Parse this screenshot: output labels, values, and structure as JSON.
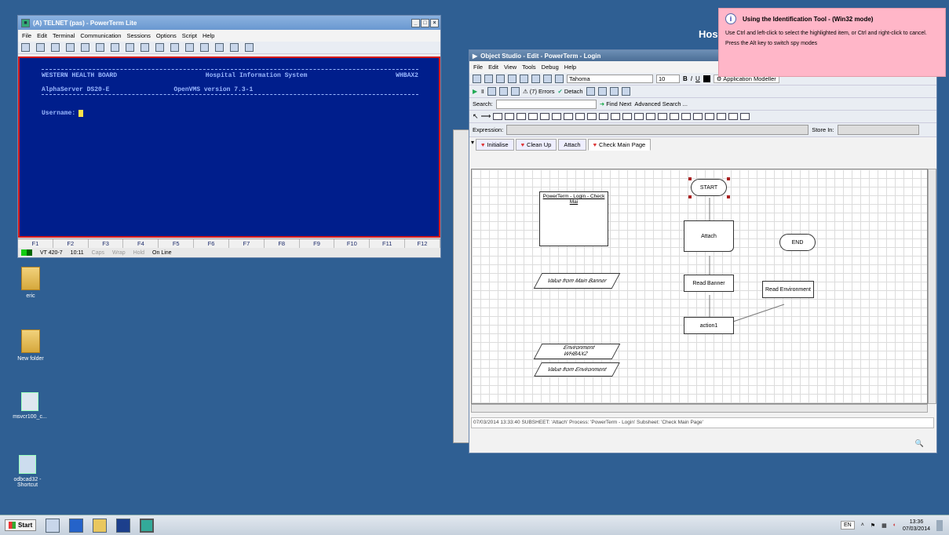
{
  "powerterm": {
    "title": "(A) TELNET (pas) - PowerTerm Lite",
    "menu": [
      "File",
      "Edit",
      "Terminal",
      "Communication",
      "Sessions",
      "Options",
      "Script",
      "Help"
    ],
    "screen": {
      "line1_left": "WESTERN HEALTH BOARD",
      "line1_mid": "Hospital Information System",
      "line1_right": "WHBAX2",
      "line2_left": "AlphaServer DS20-E",
      "line2_mid": "OpenVMS version 7.3-1",
      "username_label": "Username:"
    },
    "fkeys": [
      "F1",
      "F2",
      "F3",
      "F4",
      "F5",
      "F6",
      "F7",
      "F8",
      "F9",
      "F10",
      "F11",
      "F12"
    ],
    "status": [
      "VT 420-7",
      "10:11",
      "Caps",
      "Wrap",
      "Hold",
      "On Line"
    ]
  },
  "desktop_icons": [
    "eric",
    "New folder",
    "msvcr100_c...",
    "odbcad32 - Shortcut"
  ],
  "ide": {
    "title": "Object Studio  - Edit - PowerTerm - Login",
    "menu": [
      "File",
      "Edit",
      "View",
      "Tools",
      "Debug",
      "Help"
    ],
    "font_name": "Tahoma",
    "font_size": "10",
    "app_modeller": "Application Modeller",
    "errors": "(7) Errors",
    "detach": "Detach",
    "search_label": "Search:",
    "find_next": "Find Next",
    "advanced_search": "Advanced Search ...",
    "expression_label": "Expression:",
    "store_in_label": "Store In:",
    "tabs": [
      "Initialise",
      "Clean Up",
      "Attach",
      "Check Main Page"
    ],
    "diagram": {
      "start": "START",
      "end": "END",
      "note": "PowerTerm - Login - Check Mai",
      "attach": "Attach",
      "read_banner": "Read Banner",
      "read_env": "Read Environment",
      "action1": "action1",
      "value_main_banner": "Value from Main Banner",
      "env_line1": "Environment",
      "env_line2": "WHBAX2",
      "value_env": "Value from Environment"
    },
    "status_text": "07/03/2014 13:33:40 SUBSHEET: 'Attach' Process: 'PowerTerm - Login' Subsheet: 'Check Main Page'"
  },
  "tooltip": {
    "title": "Using the Identification Tool - (Win32 mode)",
    "line1": "Use Ctrl and left-click to select the highlighted item, or Ctrl and right-click to cancel.",
    "line2": "Press the Alt key to switch spy modes"
  },
  "bg_hos": "Hos",
  "taskbar": {
    "start": "Start",
    "lang": "EN",
    "time": "13:36",
    "date": "07/03/2014"
  },
  "colors": {
    "terminal_bg": "#001e8c",
    "terminal_text": "#9ab8ff",
    "tooltip_bg": "#ffb6c8",
    "accent": "#d61a1a"
  }
}
